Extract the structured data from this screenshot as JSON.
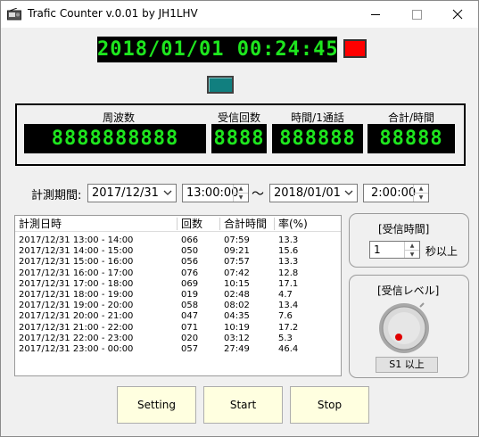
{
  "window": {
    "title": "Trafic Counter v.0.01 by JH1LHV",
    "controls": [
      "minimize-icon",
      "maximize-icon",
      "close-icon"
    ]
  },
  "clock": {
    "value": "2018/01/01 00:24:45"
  },
  "indicators": {
    "status_lamp_color": "#ff0000",
    "toggle_lamp_color": "#117f7f"
  },
  "display": {
    "frequency": {
      "label": "周波数",
      "value": "8888888888"
    },
    "received_count": {
      "label": "受信回数",
      "value": "8888"
    },
    "time_per_call": {
      "label": "時間/1通話",
      "value": "888888"
    },
    "total_time": {
      "label": "合計/時間",
      "value": "88888"
    }
  },
  "period": {
    "label": "計測期間:",
    "start_date": "2017/12/31",
    "start_time": "13:00:00",
    "separator": "〜",
    "end_date": "2018/01/01",
    "end_time": "2:00:00"
  },
  "table": {
    "columns": [
      "計測日時",
      "回数",
      "合計時間",
      "率(%)"
    ],
    "rows": [
      [
        "2017/12/31 13:00 - 14:00",
        "066",
        "07:59",
        "13.3"
      ],
      [
        "2017/12/31 14:00 - 15:00",
        "050",
        "09:21",
        "15.6"
      ],
      [
        "2017/12/31 15:00 - 16:00",
        "056",
        "07:57",
        "13.3"
      ],
      [
        "2017/12/31 16:00 - 17:00",
        "076",
        "07:42",
        "12.8"
      ],
      [
        "2017/12/31 17:00 - 18:00",
        "069",
        "10:15",
        "17.1"
      ],
      [
        "2017/12/31 18:00 - 19:00",
        "019",
        "02:48",
        "4.7"
      ],
      [
        "2017/12/31 19:00 - 20:00",
        "058",
        "08:02",
        "13.4"
      ],
      [
        "2017/12/31 20:00 - 21:00",
        "047",
        "04:35",
        "7.6"
      ],
      [
        "2017/12/31 21:00 - 22:00",
        "071",
        "10:19",
        "17.2"
      ],
      [
        "2017/12/31 22:00 - 23:00",
        "020",
        "03:12",
        "5.3"
      ],
      [
        "2017/12/31 23:00 - 00:00",
        "057",
        "27:49",
        "46.4"
      ]
    ]
  },
  "receive_time": {
    "label": "[受信時間]",
    "value": "1",
    "suffix": "秒以上"
  },
  "receive_level": {
    "label": "[受信レベル]",
    "button": "S1 以上"
  },
  "buttons": {
    "setting": "Setting",
    "start": "Start",
    "stop": "Stop"
  }
}
